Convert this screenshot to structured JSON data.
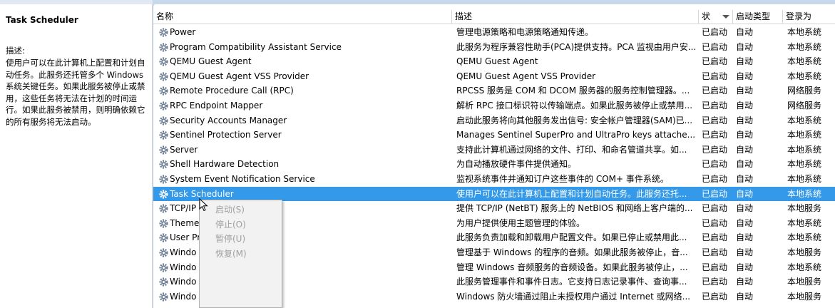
{
  "description_pane": {
    "title": "Task Scheduler",
    "label": "描述:",
    "text": "使用户可以在此计算机上配置和计划自动任务。此服务还托管多个 Windows 系统关键任务。如果此服务被停止或禁用，这些任务将无法在计划的时间运行。如果此服务被禁用，则明确依赖它的所有服务将无法启动。"
  },
  "table": {
    "columns": {
      "name": "名称",
      "description": "描述",
      "status": "状",
      "startup": "启动类型",
      "logon": "登录为"
    },
    "rows": [
      {
        "name": "Power",
        "description": "管理电源策略和电源策略通知传递。",
        "status": "已启动",
        "startup": "自动",
        "logon": "本地系统"
      },
      {
        "name": "Program Compatibility Assistant Service",
        "description": "此服务为程序兼容性助手(PCA)提供支持。PCA 监视由用户安...",
        "status": "已启动",
        "startup": "自动",
        "logon": "本地系统"
      },
      {
        "name": "QEMU Guest Agent",
        "description": "QEMU Guest Agent",
        "status": "已启动",
        "startup": "自动",
        "logon": "本地系统"
      },
      {
        "name": "QEMU Guest Agent VSS Provider",
        "description": "QEMU Guest Agent VSS Provider",
        "status": "已启动",
        "startup": "自动",
        "logon": "本地系统"
      },
      {
        "name": "Remote Procedure Call (RPC)",
        "description": "RPCSS 服务是 COM 和 DCOM 服务器的服务控制管理器。...",
        "status": "已启动",
        "startup": "自动",
        "logon": "网络服务"
      },
      {
        "name": "RPC Endpoint Mapper",
        "description": "解析 RPC 接口标识符以传输端点。如果此服务被停止或禁用...",
        "status": "已启动",
        "startup": "自动",
        "logon": "网络服务"
      },
      {
        "name": "Security Accounts Manager",
        "description": "启动此服务将向其他服务发出信号: 安全帐户管理器(SAM)已...",
        "status": "已启动",
        "startup": "自动",
        "logon": "本地系统"
      },
      {
        "name": "Sentinel Protection Server",
        "description": "Manages Sentinel SuperPro and UltraPro keys attache...",
        "status": "已启动",
        "startup": "自动",
        "logon": "本地系统"
      },
      {
        "name": "Server",
        "description": "支持此计算机通过网络的文件、打印、和命名管道共享。如...",
        "status": "已启动",
        "startup": "自动",
        "logon": "本地系统"
      },
      {
        "name": "Shell Hardware Detection",
        "description": "为自动播放硬件事件提供通知。",
        "status": "已启动",
        "startup": "自动",
        "logon": "本地系统"
      },
      {
        "name": "System Event Notification Service",
        "description": "监视系统事件并通知订户这些事件的 COM+ 事件系统。",
        "status": "已启动",
        "startup": "自动",
        "logon": "本地系统"
      },
      {
        "name": "Task Scheduler",
        "description": "使用户可以在此计算机上配置和计划自动任务。此服务还托...",
        "status": "已启动",
        "startup": "自动",
        "logon": "本地系统",
        "selected": true
      },
      {
        "name": "TCP/IP",
        "description": "提供 TCP/IP (NetBT) 服务上的 NetBIOS 和网络上客户端的...",
        "status": "已启动",
        "startup": "自动",
        "logon": "本地服务"
      },
      {
        "name": "Themes",
        "description": "为用户提供使用主题管理的体验。",
        "status": "已启动",
        "startup": "自动",
        "logon": "本地系统"
      },
      {
        "name": "User Pr",
        "description": "此服务负责加载和卸载用户配置文件。如果已停止或禁用此...",
        "status": "已启动",
        "startup": "自动",
        "logon": "本地系统"
      },
      {
        "name": "Windo",
        "description": "管理基于 Windows 的程序的音频。如果此服务被停止，音...",
        "status": "已启动",
        "startup": "自动",
        "logon": "本地服务"
      },
      {
        "name": "Windo                          uilder",
        "description": "管理 Windows 音频服务的音频设备。如果此服务被停止，...",
        "status": "已启动",
        "startup": "自动",
        "logon": "本地系统"
      },
      {
        "name": "Windo",
        "description": "此服务管理事件和事件日志。它支持日志记录事件、查询事...",
        "status": "已启动",
        "startup": "自动",
        "logon": "本地服务"
      },
      {
        "name": "Windo",
        "description": "Windows 防火墙通过阻止未授权用户通过 Internet 或网络...",
        "status": "已启动",
        "startup": "自动",
        "logon": "本地服务"
      }
    ]
  },
  "context_menu": {
    "items": [
      "启动(S)",
      "停止(O)",
      "暂停(U)",
      "恢复(M)"
    ]
  },
  "colors": {
    "selection": "#3399e8",
    "disabled_text": "#a0a0a0"
  }
}
